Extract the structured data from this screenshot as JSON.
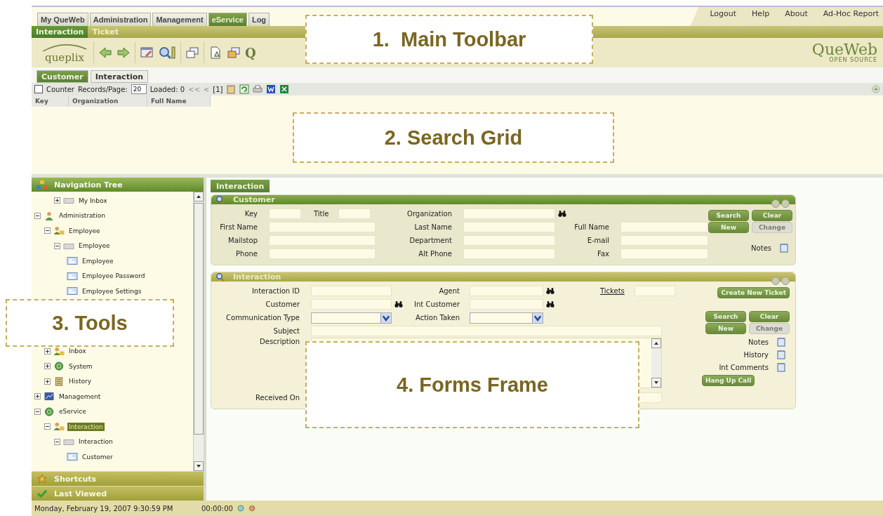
{
  "top_tabs": [
    {
      "label": "My QueWeb",
      "selected": false
    },
    {
      "label": "Administration",
      "selected": false
    },
    {
      "label": "Management",
      "selected": false
    },
    {
      "label": "eService",
      "selected": true
    },
    {
      "label": "Log",
      "selected": false
    }
  ],
  "top_links": [
    "Logout",
    "Help",
    "About",
    "Ad-Hoc Report"
  ],
  "sub_tabs": [
    {
      "label": "Interaction",
      "selected": true
    },
    {
      "label": "Ticket",
      "selected": false
    }
  ],
  "logo": {
    "text": "queplix"
  },
  "quick_search_glyph": "Q",
  "brand": {
    "name": "QueWeb",
    "tagline": "OPEN SOURCE"
  },
  "search_tabs": [
    {
      "label": "Customer",
      "selected": true
    },
    {
      "label": "Interaction",
      "selected": false
    }
  ],
  "grid_toolbar": {
    "counter": {
      "label": "Counter",
      "checked": false
    },
    "records_label": "Records/Page:",
    "records_value": "20",
    "loaded": "Loaded: 0",
    "first": "<<",
    "prev": "<",
    "page": "[1]"
  },
  "grid": {
    "columns": [
      "Key",
      "Organization",
      "Full Name"
    ]
  },
  "nav": {
    "title": "Navigation Tree",
    "tree": [
      {
        "children": [
          {
            "children": [
              {
                "label": "My Inbox",
                "kind": "folder",
                "expanded": false,
                "selected": false
              }
            ]
          }
        ]
      },
      {
        "label": "Administration",
        "kind": "person",
        "expanded": true,
        "selected": false,
        "children": [
          {
            "label": "Employee",
            "kind": "people",
            "expanded": true,
            "selected": false,
            "children": [
              {
                "label": "Employee",
                "kind": "folder",
                "expanded": true,
                "selected": false,
                "children": [
                  {
                    "label": "Employee",
                    "kind": "form",
                    "selected": false
                  },
                  {
                    "label": "Employee Password",
                    "kind": "form",
                    "selected": false
                  },
                  {
                    "label": "Employee Settings",
                    "kind": "form",
                    "selected": false
                  }
                ]
              }
            ]
          },
          {
            "label": "Inbox",
            "kind": "people",
            "expanded": false,
            "selected": false
          },
          {
            "label": "System",
            "kind": "globe",
            "expanded": false,
            "selected": false
          },
          {
            "label": "History",
            "kind": "scroll",
            "expanded": false,
            "selected": false
          }
        ]
      },
      {
        "label": "Management",
        "kind": "chart",
        "expanded": false,
        "selected": false
      },
      {
        "label": "eService",
        "kind": "globe",
        "expanded": true,
        "selected": false,
        "children": [
          {
            "label": "Interaction",
            "kind": "people",
            "expanded": true,
            "selected": true,
            "children": [
              {
                "label": "Interaction",
                "kind": "folder",
                "expanded": true,
                "selected": false,
                "children": [
                  {
                    "label": "Customer",
                    "kind": "form",
                    "selected": false
                  }
                ]
              }
            ]
          }
        ]
      }
    ],
    "sections": [
      "Shortcuts",
      "Last Viewed"
    ]
  },
  "form_tab": "Interaction",
  "customer": {
    "title": "Customer",
    "rows": [
      [
        [
          {
            "label": "Key",
            "kind": "short"
          },
          {
            "label": "Title",
            "kind": "short"
          }
        ],
        [
          {
            "label": "Organization",
            "kind": "lookup"
          }
        ],
        []
      ],
      [
        [
          {
            "label": "First Name",
            "kind": "text"
          }
        ],
        [
          {
            "label": "Last Name",
            "kind": "text"
          }
        ],
        [
          {
            "label": "Full Name",
            "kind": "text"
          }
        ]
      ],
      [
        [
          {
            "label": "Mailstop",
            "kind": "text"
          }
        ],
        [
          {
            "label": "Department",
            "kind": "text"
          }
        ],
        [
          {
            "label": "E-mail",
            "kind": "text"
          }
        ]
      ],
      [
        [
          {
            "label": "Phone",
            "kind": "text"
          }
        ],
        [
          {
            "label": "Alt Phone",
            "kind": "text"
          }
        ],
        [
          {
            "label": "Fax",
            "kind": "text"
          }
        ]
      ]
    ],
    "buttons": [
      {
        "label": "Search",
        "disabled": false
      },
      {
        "label": "Clear",
        "disabled": false
      },
      {
        "label": "New",
        "disabled": false
      },
      {
        "label": "Change",
        "disabled": true
      }
    ],
    "attachments": [
      "Notes"
    ]
  },
  "interaction": {
    "title": "Interaction",
    "rows": [
      [
        [
          {
            "label": "Interaction ID",
            "kind": "text"
          }
        ],
        [
          {
            "label": "Agent",
            "kind": "lookup"
          }
        ],
        [
          {
            "label": "Tickets",
            "kind": "link"
          }
        ]
      ],
      [
        [
          {
            "label": "Customer",
            "kind": "lookup"
          }
        ],
        [
          {
            "label": "Int Customer",
            "kind": "lookup"
          }
        ],
        []
      ],
      [
        [
          {
            "label": "Communication Type",
            "kind": "select"
          }
        ],
        [
          {
            "label": "Action Taken",
            "kind": "select"
          }
        ],
        []
      ],
      [
        [
          {
            "label": "Subject",
            "kind": "long"
          }
        ]
      ],
      [
        [
          {
            "label": "Description",
            "kind": "textarea"
          }
        ]
      ],
      [
        [
          {
            "label": "Received On",
            "kind": "long"
          }
        ]
      ]
    ],
    "top_button": {
      "label": "Create New Ticket",
      "disabled": false
    },
    "buttons": [
      {
        "label": "Search",
        "disabled": false
      },
      {
        "label": "Clear",
        "disabled": false
      },
      {
        "label": "New",
        "disabled": false
      },
      {
        "label": "Change",
        "disabled": true
      }
    ],
    "attachments": [
      "Notes",
      "History",
      "Int Comments"
    ],
    "bottom_button": {
      "label": "Hang Up Call",
      "disabled": false
    }
  },
  "status_bar": {
    "datetime": "Monday, February 19, 2007 9:30:59 PM",
    "timer": "00:00:00"
  },
  "callouts": [
    "1.  Main Toolbar",
    "2. Search Grid",
    "3. Tools",
    "4. Forms Frame"
  ]
}
